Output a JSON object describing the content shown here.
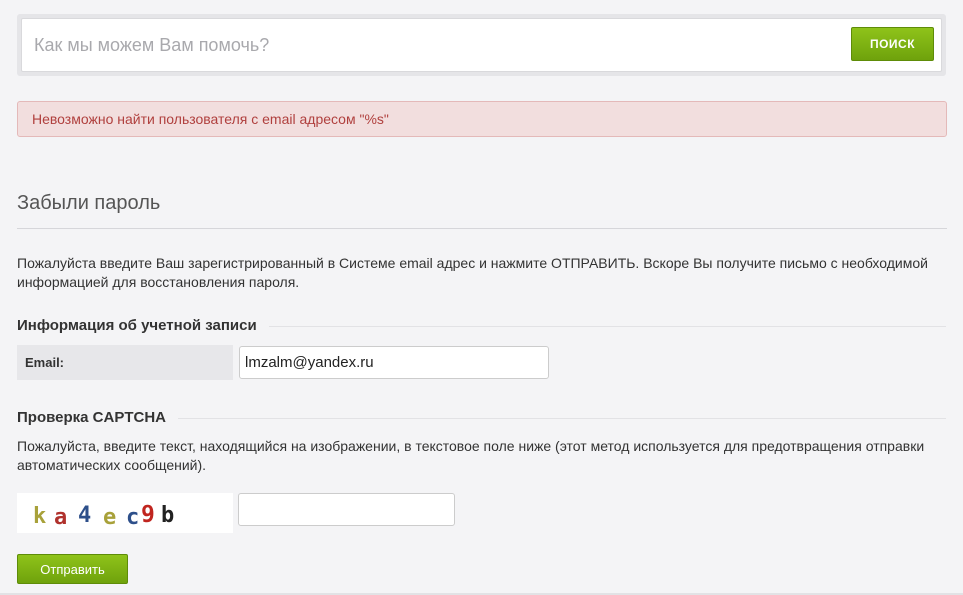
{
  "search": {
    "placeholder": "Как мы можем Вам помочь?",
    "button_label": "ПОИСК"
  },
  "alert": {
    "message": "Невозможно найти пользователя с email адресом \"%s\"",
    "color": "#b0403e"
  },
  "page": {
    "title": "Забыли пароль",
    "intro": "Пожалуйста введите Ваш зарегистрированный в Системе email адрес и нажмите ОТПРАВИТЬ. Вскоре Вы получите письмо с необходимой информацией для восстановления пароля."
  },
  "account": {
    "legend": "Информация об учетной записи",
    "email_label": "Email:",
    "email_value": "lmzalm@yandex.ru"
  },
  "captcha": {
    "legend": "Проверка CAPTCHA",
    "description": "Пожалуйста, введите текст, находящийся на изображении, в текстовое поле ниже (этот метод используется для предотвращения отправки автоматических сообщений).",
    "image_text": "ka4ec9b",
    "input_value": ""
  },
  "submit": {
    "label": "Отправить"
  },
  "colors": {
    "accent": "#7ab317",
    "background": "#f4f4f6",
    "alert_bg": "#f2dede"
  }
}
